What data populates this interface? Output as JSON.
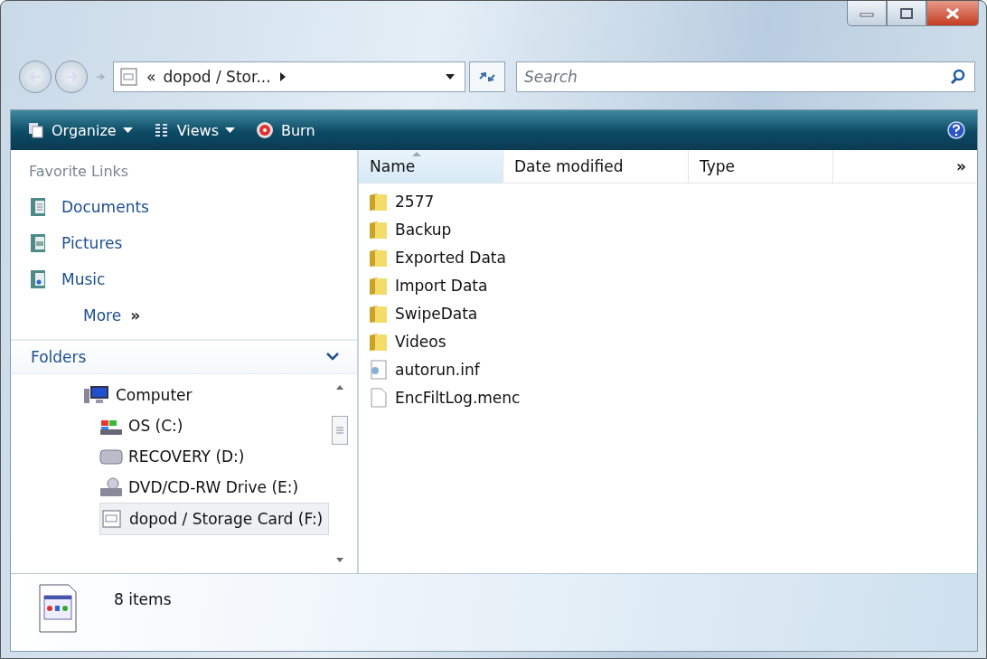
{
  "address": {
    "overflow": "«",
    "path": "dopod / Stor...",
    "has_submenu": true
  },
  "search": {
    "placeholder": "Search"
  },
  "toolbar": [
    {
      "label": "Organize",
      "kind": "organize",
      "has_menu": true
    },
    {
      "label": "Views",
      "kind": "views",
      "has_menu": true
    },
    {
      "label": "Burn",
      "kind": "burn",
      "has_menu": false
    }
  ],
  "favorite_links": {
    "heading": "Favorite Links",
    "items": [
      {
        "label": "Documents",
        "kind": "documents"
      },
      {
        "label": "Pictures",
        "kind": "pictures"
      },
      {
        "label": "Music",
        "kind": "music"
      }
    ],
    "more": {
      "label": "More",
      "arrow": "»"
    }
  },
  "folders": {
    "heading": "Folders",
    "expanded": true,
    "tree": [
      {
        "label": "Computer",
        "kind": "computer",
        "selected": false,
        "children": [
          {
            "label": "OS (C:)",
            "kind": "os-drive",
            "selected": false
          },
          {
            "label": "RECOVERY (D:)",
            "kind": "drive",
            "selected": false
          },
          {
            "label": "DVD/CD-RW Drive (E:)",
            "kind": "dvd",
            "selected": false
          },
          {
            "label": "dopod / Storage Card (F:)",
            "kind": "card",
            "selected": true
          }
        ]
      }
    ]
  },
  "columns": [
    {
      "label": "Name",
      "sorted": true
    },
    {
      "label": "Date modified",
      "sorted": false
    },
    {
      "label": "Type",
      "sorted": false
    }
  ],
  "columns_more": "»",
  "files": [
    {
      "name": "2577",
      "kind": "folder"
    },
    {
      "name": "Backup",
      "kind": "folder"
    },
    {
      "name": "Exported Data",
      "kind": "folder"
    },
    {
      "name": "Import Data",
      "kind": "folder"
    },
    {
      "name": "SwipeData",
      "kind": "folder"
    },
    {
      "name": "Videos",
      "kind": "folder"
    },
    {
      "name": "autorun.inf",
      "kind": "settings"
    },
    {
      "name": "EncFiltLog.menc",
      "kind": "file"
    }
  ],
  "status_bar": {
    "count": "8 items"
  }
}
